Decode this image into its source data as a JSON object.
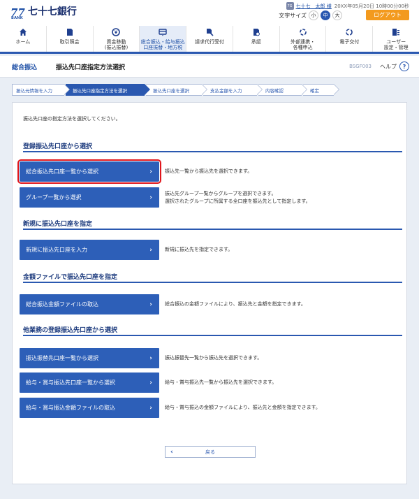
{
  "header": {
    "logo_mark": "77",
    "logo_bank": "BANK",
    "logo_name": "七十七銀行",
    "user_icon_label": "7G",
    "user_name": "七十七　太郎 様",
    "datetime": "20XX年05月20日 10時00分00秒",
    "fontsize_label": "文字サイズ",
    "fontsize_small": "小",
    "fontsize_medium": "中",
    "fontsize_large": "大",
    "logout": "ログアウト"
  },
  "nav": [
    {
      "label": "ホーム",
      "icon": "home-icon"
    },
    {
      "label": "取引照会",
      "icon": "document-icon"
    },
    {
      "label": "資金移動\n(振込振替)",
      "icon": "yen-transfer-icon"
    },
    {
      "label": "総合振込・給与振込\n口座振替・地方税",
      "icon": "card-icon"
    },
    {
      "label": "請求代行受付",
      "icon": "request-icon"
    },
    {
      "label": "承認",
      "icon": "approve-icon"
    },
    {
      "label": "外部連携・\n各種申込",
      "icon": "link-icon"
    },
    {
      "label": "電子交付",
      "icon": "electronic-icon"
    },
    {
      "label": "ユーザー\n設定・管理",
      "icon": "user-settings-icon"
    }
  ],
  "titlebar": {
    "group": "総合振込",
    "screen": "振込先口座指定方法選択",
    "screen_id": "BSGF003",
    "help": "ヘルプ",
    "help_icon": "?"
  },
  "steps": [
    "振込元情報を入力",
    "振込先口座指定方法を選択",
    "振込先口座を選択",
    "支払金額を入力",
    "内容確認",
    "確定"
  ],
  "main": {
    "intro": "振込先口座の指定方法を選択してください。",
    "sections": [
      {
        "heading": "登録振込先口座から選択",
        "items": [
          {
            "label": "総合振込先口座一覧から選択",
            "desc": "振込先一覧から振込先を選択できます。"
          },
          {
            "label": "グループ一覧から選択",
            "desc": "振込先グループ一覧からグループを選択できます。\n選択されたグループに所属する全口座を振込先として指定します。"
          }
        ]
      },
      {
        "heading": "新規に振込先口座を指定",
        "items": [
          {
            "label": "新規に振込先口座を入力",
            "desc": "新規に振込先を指定できます。"
          }
        ]
      },
      {
        "heading": "金額ファイルで振込先口座を指定",
        "items": [
          {
            "label": "総合振込金額ファイルの取込",
            "desc": "総合振込の金額ファイルにより、振込先と金額を指定できます。"
          }
        ]
      },
      {
        "heading": "他業務の登録振込先口座から選択",
        "items": [
          {
            "label": "振込振替先口座一覧から選択",
            "desc": "振込振替先一覧から振込先を選択できます。"
          },
          {
            "label": "給与・賞与振込先口座一覧から選択",
            "desc": "給与・賞与振込先一覧から振込先を選択できます。"
          },
          {
            "label": "給与・賞与振込金額ファイルの取込",
            "desc": "給与・賞与振込の金額ファイルにより、振込先と金額を指定できます。"
          }
        ]
      }
    ],
    "back": "戻る",
    "chevron_right": "›",
    "chevron_left": "‹"
  }
}
